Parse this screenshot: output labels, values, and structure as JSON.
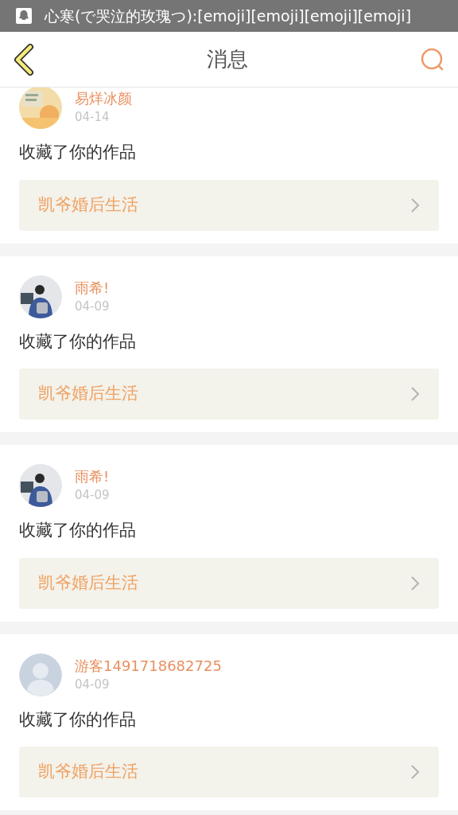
{
  "status_bar": {
    "notification": "心寒(で哭泣的玫瑰つ):[emoji][emoji][emoji][emoji]"
  },
  "header": {
    "title": "消息"
  },
  "messages": [
    {
      "name": "易烊冰颜",
      "date": "04-14",
      "action": "收藏了你的作品",
      "work": "凯爷婚后生活"
    },
    {
      "name": "雨希!",
      "date": "04-09",
      "action": "收藏了你的作品",
      "work": "凯爷婚后生活"
    },
    {
      "name": "雨希!",
      "date": "04-09",
      "action": "收藏了你的作品",
      "work": "凯爷婚后生活"
    },
    {
      "avatar": {
        "kind": "default"
      },
      "name": "游客1491718682725",
      "date": "04-09",
      "action": "收藏了你的作品",
      "work": "凯爷婚后生活"
    }
  ]
}
